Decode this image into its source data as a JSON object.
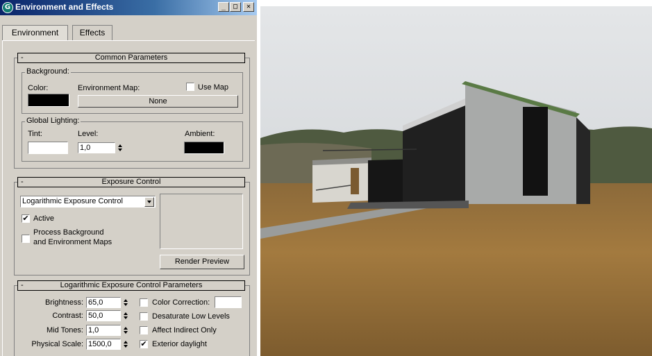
{
  "window": {
    "title": "Environment and Effects",
    "controls": {
      "minimize": "_",
      "maximize": "□",
      "close": "✕"
    },
    "app_icon": "max-logo-icon"
  },
  "tabs": [
    {
      "label": "Environment",
      "active": true
    },
    {
      "label": "Effects",
      "active": false
    }
  ],
  "common": {
    "title": "Common Parameters",
    "collapse": "-",
    "background": {
      "group_label": "Background:",
      "color_label": "Color:",
      "color": "#000000",
      "envmap_label": "Environment Map:",
      "use_map_label": "Use Map",
      "use_map": false,
      "map_button": "None"
    },
    "lighting": {
      "group_label": "Global Lighting:",
      "tint_label": "Tint:",
      "tint": "#ffffff",
      "level_label": "Level:",
      "level": "1,0",
      "ambient_label": "Ambient:",
      "ambient": "#000000"
    }
  },
  "exposure": {
    "title": "Exposure Control",
    "collapse": "-",
    "type": "Logarithmic Exposure Control",
    "active_label": "Active",
    "active": true,
    "process_bg_label_1": "Process Background",
    "process_bg_label_2": "and Environment Maps",
    "process_bg": false,
    "render_preview": "Render Preview"
  },
  "log": {
    "title": "Logarithmic Exposure Control Parameters",
    "collapse": "-",
    "brightness_label": "Brightness:",
    "brightness": "65,0",
    "contrast_label": "Contrast:",
    "contrast": "50,0",
    "midtones_label": "Mid Tones:",
    "midtones": "1,0",
    "physical_label": "Physical Scale:",
    "physical": "1500,0",
    "color_correction_label": "Color Correction:",
    "color_correction": false,
    "color_correction_swatch": "#ffffff",
    "desaturate_label": "Desaturate Low Levels",
    "desaturate": false,
    "affect_indirect_label": "Affect Indirect Only",
    "affect_indirect": false,
    "exterior_label": "Exterior daylight",
    "exterior": true
  },
  "check_mark": "✔"
}
